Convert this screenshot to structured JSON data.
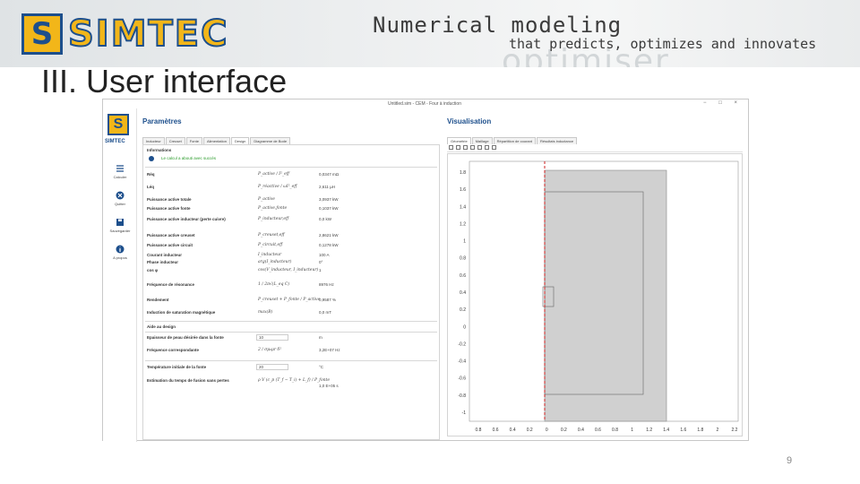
{
  "banner": {
    "logo_text": "SIMTEC",
    "headline": "Numerical modeling",
    "tagline": "that predicts, optimizes and innovates",
    "watermark": "optimiser",
    "colors": {
      "logo_yellow": "#f2b619",
      "logo_blue": "#1d4f8c"
    }
  },
  "slide": {
    "title": "III. User interface",
    "page_number": "9"
  },
  "app": {
    "window_title": "Untitled.sim - CEM - Four à induction",
    "window_controls": [
      "−",
      "□",
      "×"
    ],
    "rail": {
      "logo_letter": "S",
      "logo_word": "SIMTEC",
      "buttons": [
        {
          "label": "Calculer",
          "icon": "menu-icon"
        },
        {
          "label": "Quitter",
          "icon": "close-circle-icon"
        },
        {
          "label": "Sauvegarder",
          "icon": "save-icon"
        },
        {
          "label": "A propos",
          "icon": "info-icon"
        }
      ]
    },
    "params": {
      "title": "Paramètres",
      "tabs": [
        "Inducteur",
        "Creuset",
        "Fonte",
        "Alimentation",
        "Design",
        "Diagramme de Bode"
      ],
      "active_tab": "Design",
      "info_title": "Informations",
      "info_message": "Le calcul a abouti avec succès",
      "rows": [
        {
          "label": "Réq",
          "formula": "P_active / I²_eff",
          "value": "0,0347 mΩ"
        },
        {
          "label": "Léq",
          "formula": "P_réactive / ωI²_eff",
          "value": "2,611 µH"
        },
        {
          "label": "Puissance active totale",
          "formula": "P_active",
          "value": "3,0937 kW"
        },
        {
          "label": "Puissance active fonte",
          "formula": "P_active,fonte",
          "value": "0,1037 kW"
        },
        {
          "label": "Puissance active inducteur (perte cuivre)",
          "formula": "P_inducteur,eff",
          "value": "0,0 kW"
        },
        {
          "label": "Puissance active creuset",
          "formula": "P_creuset,eff",
          "value": "2,8621 kW"
        },
        {
          "label": "Puissance active circuit",
          "formula": "P_circuit,eff",
          "value": "0,1278 kW"
        },
        {
          "label": "Courant inducteur",
          "formula": "I_inducteur",
          "value": "100 A"
        },
        {
          "label": "Phase inducteur",
          "formula": "arg(I_inducteur)",
          "value": "0°"
        },
        {
          "label": "cos φ",
          "formula": "cos(V_inducteur, I_inducteur)",
          "value": "1"
        },
        {
          "label": "Fréquence de résonance",
          "formula": "1 / 2π√(L_eq C)",
          "value": "8976 Hz"
        },
        {
          "label": "Rendement",
          "formula": "P_creuset + P_fonte / P_active",
          "value": "0,9587 %"
        },
        {
          "label": "Induction de saturation magnétique",
          "formula": "max(B)",
          "value": "0,0 mT"
        }
      ],
      "design_title": "Aide au design",
      "design_rows": [
        {
          "label": "Epaisseur de peau désirée dans la fonte",
          "input": "10",
          "unit": "m"
        },
        {
          "label": "Fréquence correspondante",
          "formula": "2 / σμ₀μr δ²",
          "value": "3,2E+07 Hz"
        }
      ],
      "temp_rows": [
        {
          "label": "Température initiale de la fonte",
          "input": "20",
          "unit": "°C"
        },
        {
          "label": "Estimation du temps de fusion sans pertes",
          "formula": "ρ V (c_p (T_f − T_i) + L_f) / P_fonte",
          "value": "1,0 E+05 s"
        }
      ]
    },
    "viz": {
      "title": "Visualisation",
      "tabs": [
        "Géométrie",
        "Maillage",
        "Répartition de courant",
        "Résultats inductance"
      ],
      "active_tab": "Géométrie",
      "toolbar_icons": [
        "pointer-icon",
        "zoom-in-icon",
        "zoom-out-icon",
        "pan-icon",
        "fit-icon",
        "grid-icon",
        "save-image-icon"
      ],
      "x_ticks": [
        "0.8",
        "0.6",
        "0.4",
        "0.2",
        "0",
        "0.2",
        "0.4",
        "0.6",
        "0.8",
        "1",
        "1.2",
        "1.4",
        "1.6",
        "1.8",
        "2",
        "2.2"
      ],
      "y_ticks": [
        "1.8",
        "1.6",
        "1.4",
        "1.2",
        "1",
        "0.8",
        "0.6",
        "0.4",
        "0.2",
        "0",
        "-0.2",
        "-0.4",
        "-0.6",
        "-0.8",
        "-1"
      ],
      "colors": {
        "axis_line": "#cc2222",
        "region": "#d0d0d0"
      }
    }
  }
}
